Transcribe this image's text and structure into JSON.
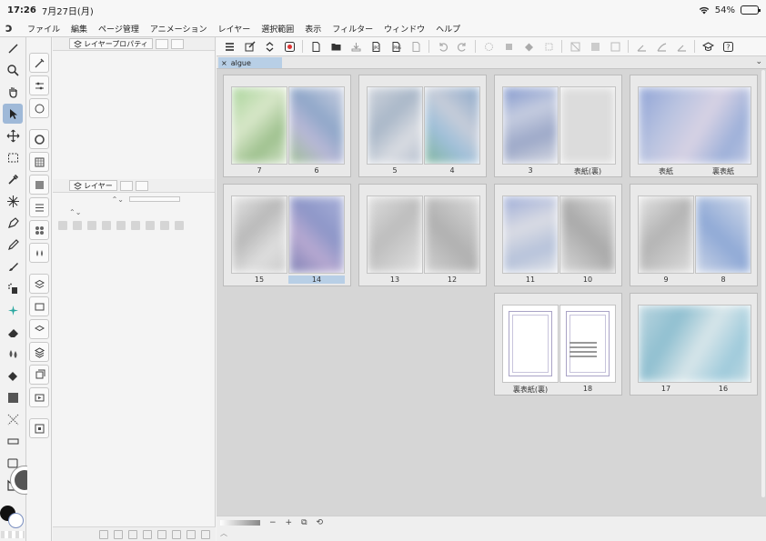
{
  "status_bar": {
    "time": "17:26",
    "date": "7月27日(月)",
    "battery": "54%",
    "battery_level": 0.54
  },
  "menubar": {
    "items": [
      "ファイル",
      "編集",
      "ページ管理",
      "アニメーション",
      "レイヤー",
      "選択範囲",
      "表示",
      "フィルター",
      "ウィンドウ",
      "ヘルプ"
    ]
  },
  "panels": {
    "layer_property_title": "レイヤープロパティ",
    "layer_title": "レイヤー"
  },
  "document": {
    "tab_name": "algue"
  },
  "pages": {
    "spreads": [
      {
        "left": "7",
        "right": "6"
      },
      {
        "left": "5",
        "right": "4"
      },
      {
        "left": "3",
        "right": "表紙(裏)"
      },
      {
        "left": "表紙",
        "right": "裏表紙"
      },
      {
        "left": "15",
        "right": "14",
        "selected": "right"
      },
      {
        "left": "13",
        "right": "12"
      },
      {
        "left": "11",
        "right": "10"
      },
      {
        "left": "9",
        "right": "8"
      },
      {
        "left": "裏表紙(裏)",
        "right": "18"
      },
      {
        "left": "17",
        "right": "16"
      }
    ]
  },
  "zoom": {
    "minus": "−",
    "plus": "+"
  }
}
